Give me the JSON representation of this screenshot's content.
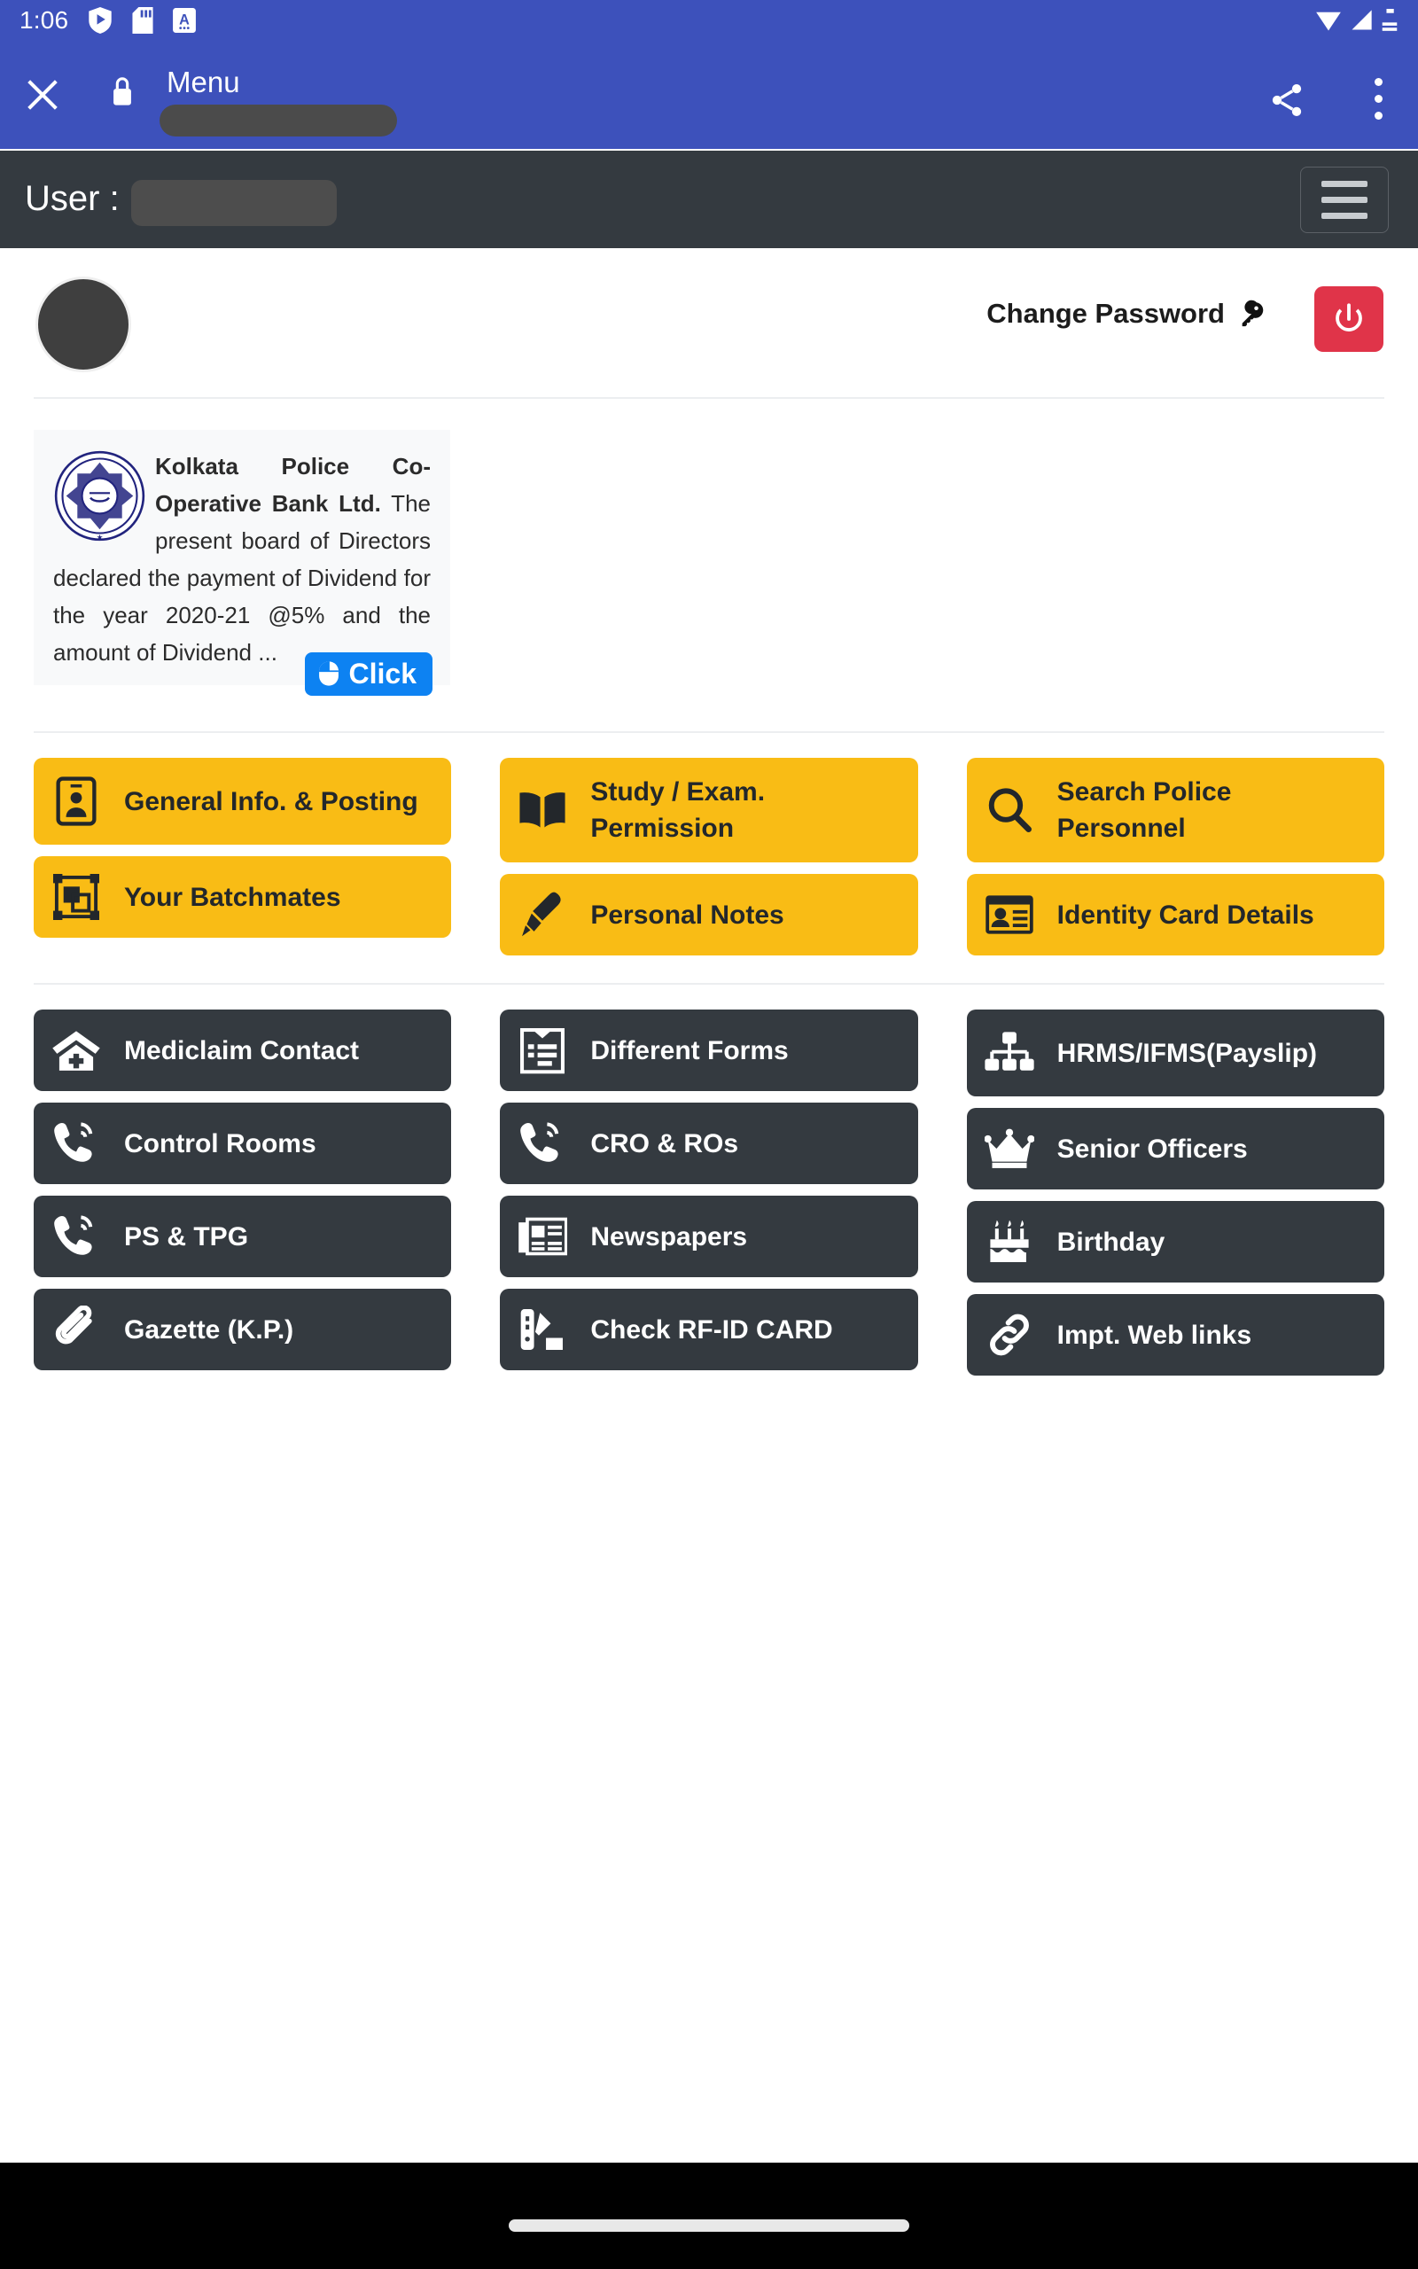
{
  "status_bar": {
    "time": "1:06",
    "left_icons": [
      "shield-play-icon",
      "sd-card-icon",
      "app-a-icon"
    ],
    "right_icons": [
      "wifi-icon",
      "cellular-signal-icon",
      "battery-icon"
    ]
  },
  "browser_toolbar": {
    "close_label": "close-icon",
    "security_icon": "lock-icon",
    "title": "Menu",
    "url_redacted": true,
    "share_label": "share-icon",
    "overflow_label": "more-options-icon",
    "background_color": "#3d51bb"
  },
  "navbar": {
    "user_label": "User :",
    "user_value_redacted": true,
    "toggler_label": "menu-toggle",
    "background_color": "#343a40"
  },
  "account_bar": {
    "avatar_redacted": true,
    "change_password_label": "Change Password",
    "change_password_icon": "key-icon",
    "logout_icon": "power-icon",
    "logout_color": "#e03449"
  },
  "notice": {
    "logo_alt": "kolkata-police-co-operative-bank-logo",
    "title": "Kolkata Police Co-Operative Bank Ltd.",
    "body": " The present board of Directors declared the payment of Dividend for the year 2020-21 @5% and the amount of Dividend ...",
    "button_label": "Click",
    "button_icon": "mouse-icon",
    "button_color": "#0d82f2"
  },
  "primary_tiles": {
    "color": "#f9bc15",
    "text_color": "#23272b",
    "columns": [
      {
        "items": [
          {
            "label": "General Info. & Posting",
            "icon": "contact-card-icon",
            "two_line": true
          },
          {
            "label": "Your Batchmates",
            "icon": "group-frame-icon",
            "two_line": false
          }
        ]
      },
      {
        "items": [
          {
            "label": "Study / Exam. Permission",
            "icon": "open-book-icon",
            "two_line": true
          },
          {
            "label": "Personal Notes",
            "icon": "pen-nib-icon",
            "two_line": false
          }
        ]
      },
      {
        "items": [
          {
            "label": "Search Police Personnel",
            "icon": "search-icon",
            "two_line": true
          },
          {
            "label": "Identity Card Details",
            "icon": "id-card-icon",
            "two_line": false
          }
        ]
      }
    ]
  },
  "secondary_tiles": {
    "color": "#343a40",
    "text_color": "#ffffff",
    "columns": [
      {
        "items": [
          {
            "label": "Mediclaim Contact",
            "icon": "hospital-icon",
            "two_line": false
          },
          {
            "label": "Control Rooms",
            "icon": "phone-volume-icon",
            "two_line": false
          },
          {
            "label": "PS & TPG",
            "icon": "phone-volume-icon",
            "two_line": false
          },
          {
            "label": "Gazette (K.P.)",
            "icon": "paperclip-icon",
            "two_line": false
          }
        ]
      },
      {
        "items": [
          {
            "label": "Different Forms",
            "icon": "form-clipboard-icon",
            "two_line": false
          },
          {
            "label": "CRO & ROs",
            "icon": "phone-volume-icon",
            "two_line": false
          },
          {
            "label": "Newspapers",
            "icon": "newspaper-icon",
            "two_line": false
          },
          {
            "label": "Check RF-ID CARD",
            "icon": "rfid-card-icon",
            "two_line": false
          }
        ]
      },
      {
        "items": [
          {
            "label": "HRMS/IFMS(Payslip)",
            "icon": "sitemap-icon",
            "two_line": true
          },
          {
            "label": "Senior Officers",
            "icon": "crown-icon",
            "two_line": false
          },
          {
            "label": "Birthday",
            "icon": "birthday-cake-icon",
            "two_line": false
          },
          {
            "label": "Impt. Web links",
            "icon": "link-icon",
            "two_line": false
          }
        ]
      }
    ]
  },
  "system_nav": {
    "gesture_pill": true,
    "background_color": "#000000"
  }
}
